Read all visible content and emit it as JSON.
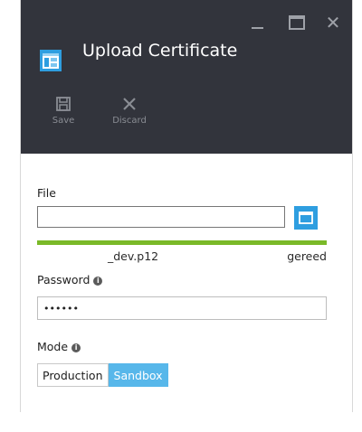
{
  "window": {
    "title": "Upload Certificate",
    "controls": [
      "minimize-icon",
      "maximize-icon",
      "close-icon"
    ]
  },
  "commands": [
    {
      "label": "Save",
      "icon": "save-icon"
    },
    {
      "label": "Discard",
      "icon": "discard-icon"
    }
  ],
  "form": {
    "file_label": "File",
    "file_value": "",
    "upload": {
      "progress_percent": 100,
      "file_name": "_dev.p12",
      "status": "gereed"
    },
    "password_label": "Password",
    "password_value": "••••••",
    "mode_label": "Mode",
    "mode_options": [
      {
        "label": "Production",
        "selected": false
      },
      {
        "label": "Sandbox",
        "selected": true
      }
    ]
  },
  "colors": {
    "header_bg": "#32343c",
    "accent_blue": "#2e9ee0",
    "selected_blue": "#57b7ea",
    "progress_green": "#7ab928"
  }
}
